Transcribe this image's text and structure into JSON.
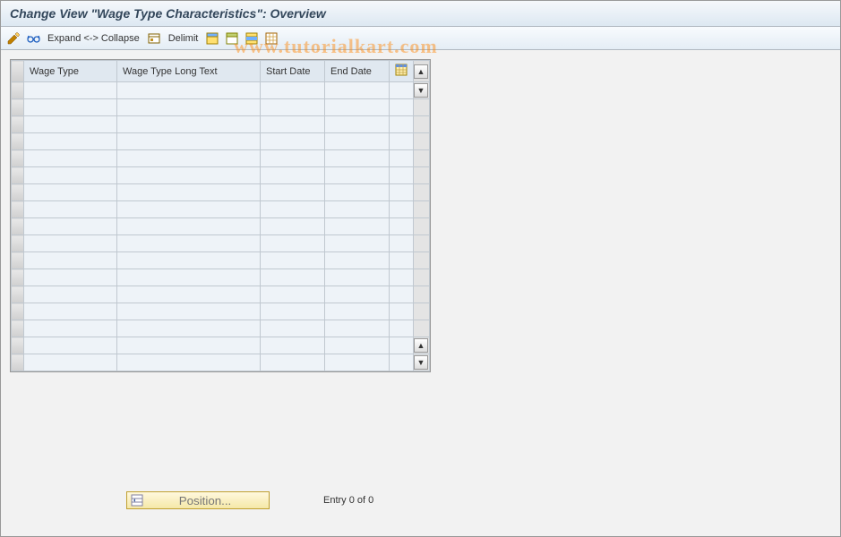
{
  "title": "Change View \"Wage Type Characteristics\": Overview",
  "toolbar": {
    "expand_collapse_label": "Expand <-> Collapse",
    "delimit_label": "Delimit"
  },
  "grid": {
    "columns": {
      "wage_type": "Wage Type",
      "long_text": "Wage Type Long Text",
      "start_date": "Start Date",
      "end_date": "End Date"
    },
    "row_count": 17,
    "rows": []
  },
  "footer": {
    "position_label": "Position...",
    "entry_text": "Entry 0 of 0"
  },
  "watermark": "www.tutorialkart.com"
}
